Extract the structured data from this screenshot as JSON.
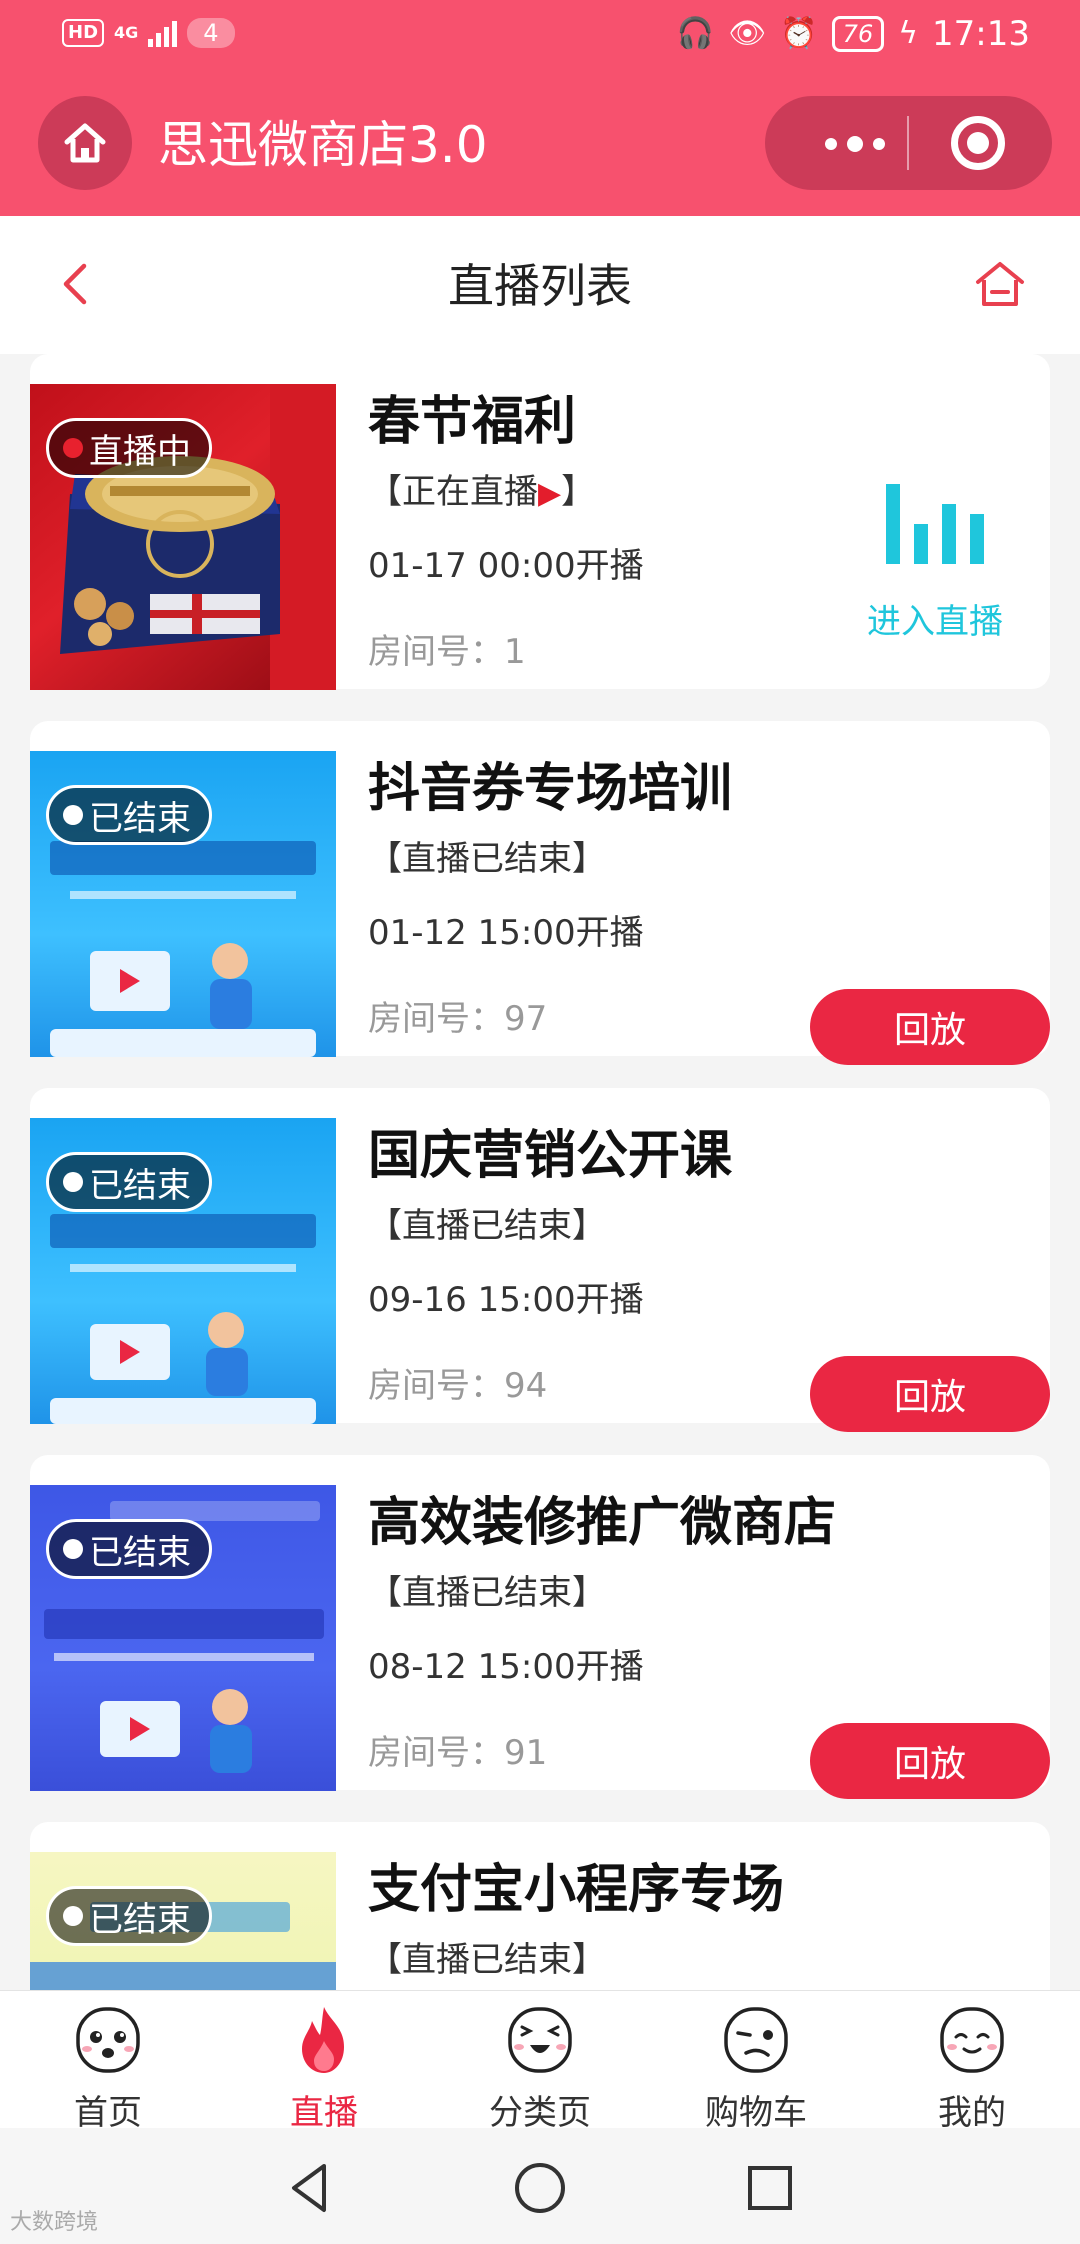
{
  "status_bar": {
    "hd": "HD",
    "network": "4G",
    "count": "4",
    "battery": "76",
    "time": "17:13"
  },
  "app_bar": {
    "title": "思迅微商店3.0"
  },
  "header": {
    "title": "直播列表"
  },
  "streams": [
    {
      "title": "春节福利",
      "badge": "直播中",
      "status": "【正在直播",
      "status_suffix": "】",
      "time": "01-17 00:00开播",
      "room_label": "房间号：",
      "room": "1",
      "action": "进入直播"
    },
    {
      "title": "抖音券专场培训",
      "badge": "已结束",
      "status": "【直播已结束】",
      "time": "01-12 15:00开播",
      "room_label": "房间号：",
      "room": "97",
      "action": "回放"
    },
    {
      "title": "国庆营销公开课",
      "badge": "已结束",
      "status": "【直播已结束】",
      "time": "09-16 15:00开播",
      "room_label": "房间号：",
      "room": "94",
      "action": "回放"
    },
    {
      "title": "高效装修推广微商店",
      "badge": "已结束",
      "status": "【直播已结束】",
      "time": "08-12 15:00开播",
      "room_label": "房间号：",
      "room": "91",
      "action": "回放"
    },
    {
      "title": "支付宝小程序专场",
      "badge": "已结束",
      "status": "【直播已结束】"
    }
  ],
  "tabs": [
    {
      "label": "首页",
      "icon": "face-surprised-icon"
    },
    {
      "label": "直播",
      "icon": "flame-icon",
      "active": true
    },
    {
      "label": "分类页",
      "icon": "face-laughing-icon"
    },
    {
      "label": "购物车",
      "icon": "face-wink-icon"
    },
    {
      "label": "我的",
      "icon": "face-smile-icon"
    }
  ],
  "watermark": "大数跨境",
  "colors": {
    "brand": "#f7516e",
    "accent": "#ea2743",
    "live_cyan": "#1fc6dc"
  }
}
